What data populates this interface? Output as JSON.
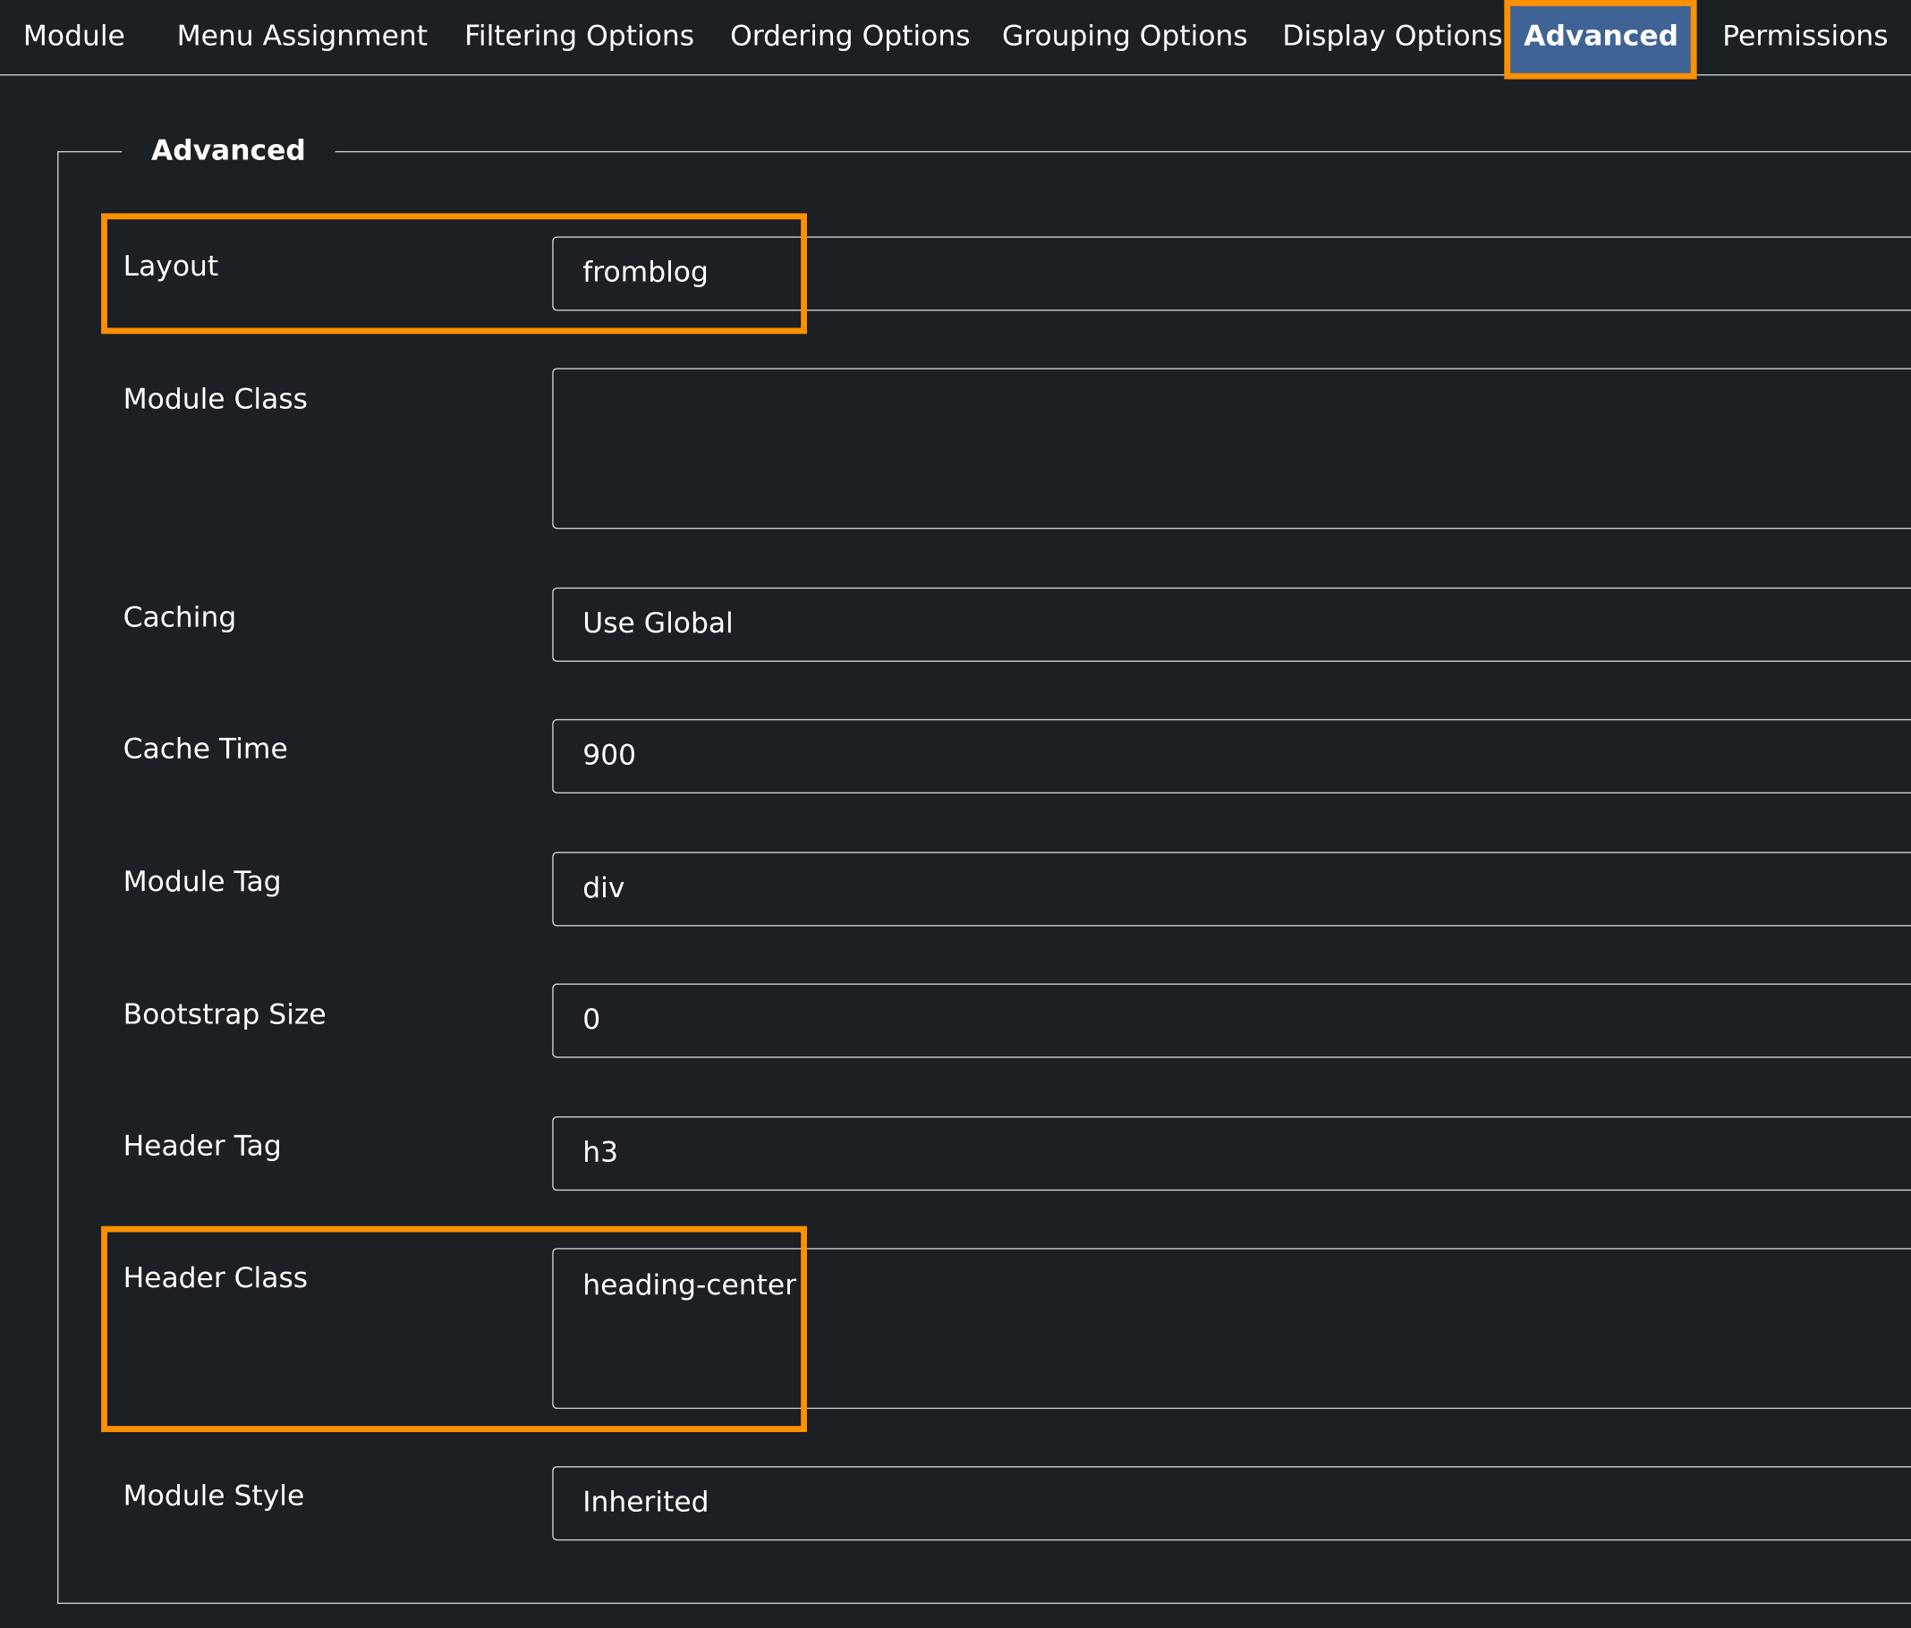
{
  "tabs": [
    {
      "label": "Module"
    },
    {
      "label": "Menu Assignment"
    },
    {
      "label": "Filtering Options"
    },
    {
      "label": "Ordering Options"
    },
    {
      "label": "Grouping Options"
    },
    {
      "label": "Display Options"
    },
    {
      "label": "Advanced",
      "active": true
    },
    {
      "label": "Permissions"
    }
  ],
  "section": {
    "legend": "Advanced"
  },
  "fields": [
    {
      "label": "Layout",
      "value": "fromblog"
    },
    {
      "label": "Module Class",
      "value": ""
    },
    {
      "label": "Caching",
      "value": "Use Global"
    },
    {
      "label": "Cache Time",
      "value": "900"
    },
    {
      "label": "Module Tag",
      "value": "div"
    },
    {
      "label": "Bootstrap Size",
      "value": "0"
    },
    {
      "label": "Header Tag",
      "value": "h3"
    },
    {
      "label": "Header Class",
      "value": "heading-center"
    },
    {
      "label": "Module Style",
      "value": "Inherited"
    }
  ],
  "colors": {
    "background": "#1c1f23",
    "active_tab": "#3f6394",
    "highlight": "#ff9000",
    "border": "#c9d3df"
  }
}
